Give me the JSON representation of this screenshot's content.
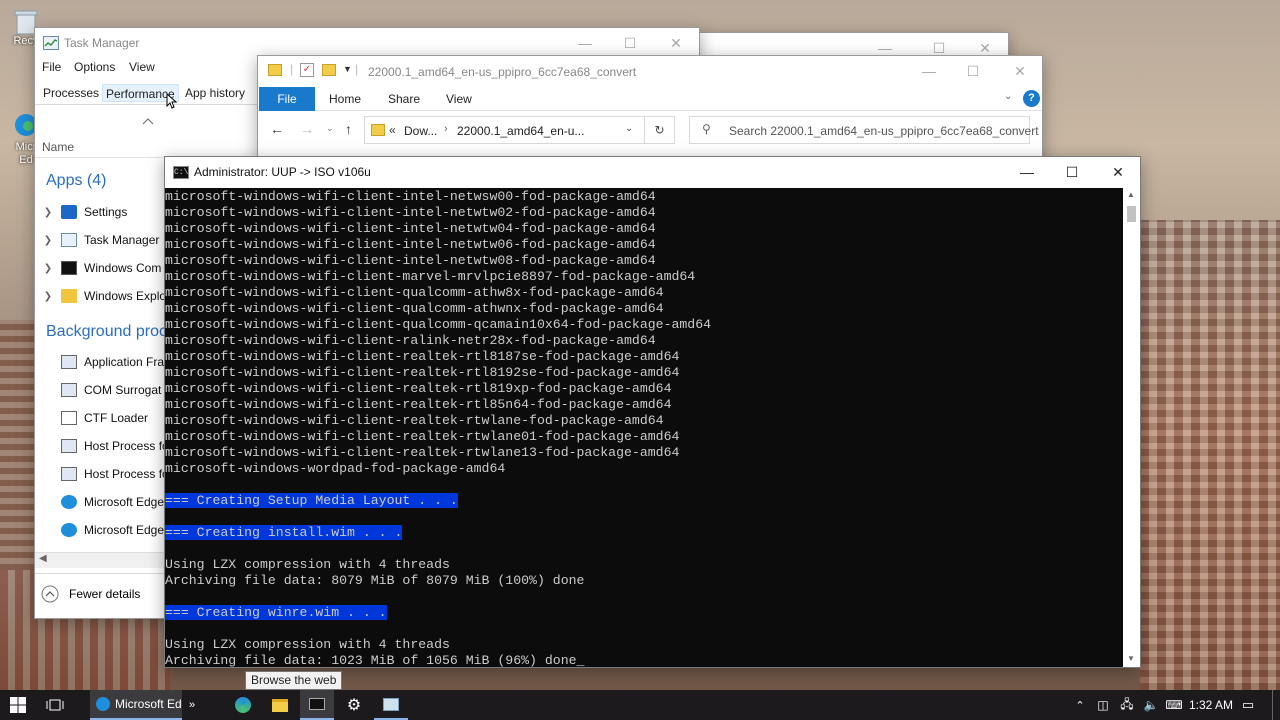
{
  "desktop": {
    "icons": [
      "Recy",
      "Micr\nEd"
    ]
  },
  "task_manager": {
    "title": "Task Manager",
    "menu": [
      "File",
      "Options",
      "View"
    ],
    "tabs": [
      "Processes",
      "Performance",
      "App history"
    ],
    "column_name": "Name",
    "apps_header": "Apps (4)",
    "apps": [
      "Settings",
      "Task Manager",
      "Windows Com",
      "Windows Explo"
    ],
    "bg_header": "Background proc",
    "background": [
      "Application Fra",
      "COM Surrogat",
      "CTF Loader",
      "Host Process fo",
      "Host Process fo",
      "Microsoft Edge",
      "Microsoft Edge"
    ],
    "fewer_details": "Fewer details"
  },
  "explorer": {
    "title": "22000.1_amd64_en-us_ppipro_6cc7ea68_convert",
    "ribbon_tabs": [
      "File",
      "Home",
      "Share",
      "View"
    ],
    "breadcrumb_parent": "Dow...",
    "breadcrumb_current": "22000.1_amd64_en-u...",
    "search_placeholder": "Search 22000.1_amd64_en-us_ppipro_6cc7ea68_convert",
    "accent": "#1979ca"
  },
  "cmd": {
    "title": "Administrator:  UUP -> ISO v106u",
    "lines": [
      {
        "text": "microsoft-windows-wifi-client-intel-netwsw00-fod-package-amd64",
        "hl": false
      },
      {
        "text": "microsoft-windows-wifi-client-intel-netwtw02-fod-package-amd64",
        "hl": false
      },
      {
        "text": "microsoft-windows-wifi-client-intel-netwtw04-fod-package-amd64",
        "hl": false
      },
      {
        "text": "microsoft-windows-wifi-client-intel-netwtw06-fod-package-amd64",
        "hl": false
      },
      {
        "text": "microsoft-windows-wifi-client-intel-netwtw08-fod-package-amd64",
        "hl": false
      },
      {
        "text": "microsoft-windows-wifi-client-marvel-mrvlpcie8897-fod-package-amd64",
        "hl": false
      },
      {
        "text": "microsoft-windows-wifi-client-qualcomm-athw8x-fod-package-amd64",
        "hl": false
      },
      {
        "text": "microsoft-windows-wifi-client-qualcomm-athwnx-fod-package-amd64",
        "hl": false
      },
      {
        "text": "microsoft-windows-wifi-client-qualcomm-qcamain10x64-fod-package-amd64",
        "hl": false
      },
      {
        "text": "microsoft-windows-wifi-client-ralink-netr28x-fod-package-amd64",
        "hl": false
      },
      {
        "text": "microsoft-windows-wifi-client-realtek-rtl8187se-fod-package-amd64",
        "hl": false
      },
      {
        "text": "microsoft-windows-wifi-client-realtek-rtl8192se-fod-package-amd64",
        "hl": false
      },
      {
        "text": "microsoft-windows-wifi-client-realtek-rtl819xp-fod-package-amd64",
        "hl": false
      },
      {
        "text": "microsoft-windows-wifi-client-realtek-rtl85n64-fod-package-amd64",
        "hl": false
      },
      {
        "text": "microsoft-windows-wifi-client-realtek-rtwlane-fod-package-amd64",
        "hl": false
      },
      {
        "text": "microsoft-windows-wifi-client-realtek-rtwlane01-fod-package-amd64",
        "hl": false
      },
      {
        "text": "microsoft-windows-wifi-client-realtek-rtwlane13-fod-package-amd64",
        "hl": false
      },
      {
        "text": "microsoft-windows-wordpad-fod-package-amd64",
        "hl": false
      },
      {
        "text": "",
        "hl": false
      },
      {
        "text": "=== Creating Setup Media Layout . . .",
        "hl": true
      },
      {
        "text": "",
        "hl": false
      },
      {
        "text": "=== Creating install.wim . . .",
        "hl": true
      },
      {
        "text": "",
        "hl": false
      },
      {
        "text": "Using LZX compression with 4 threads",
        "hl": false
      },
      {
        "text": "Archiving file data: 8079 MiB of 8079 MiB (100%) done",
        "hl": false
      },
      {
        "text": "",
        "hl": false
      },
      {
        "text": "=== Creating winre.wim . . .",
        "hl": true
      },
      {
        "text": "",
        "hl": false
      },
      {
        "text": "Using LZX compression with 4 threads",
        "hl": false
      },
      {
        "text": "Archiving file data: 1023 MiB of 1056 MiB (96%) done_",
        "hl": false
      }
    ],
    "highlight_color": "#0037da"
  },
  "taskbar": {
    "edge_label": "Microsoft Ed",
    "tooltip": "Browse the web",
    "clock": "1:32 AM"
  }
}
